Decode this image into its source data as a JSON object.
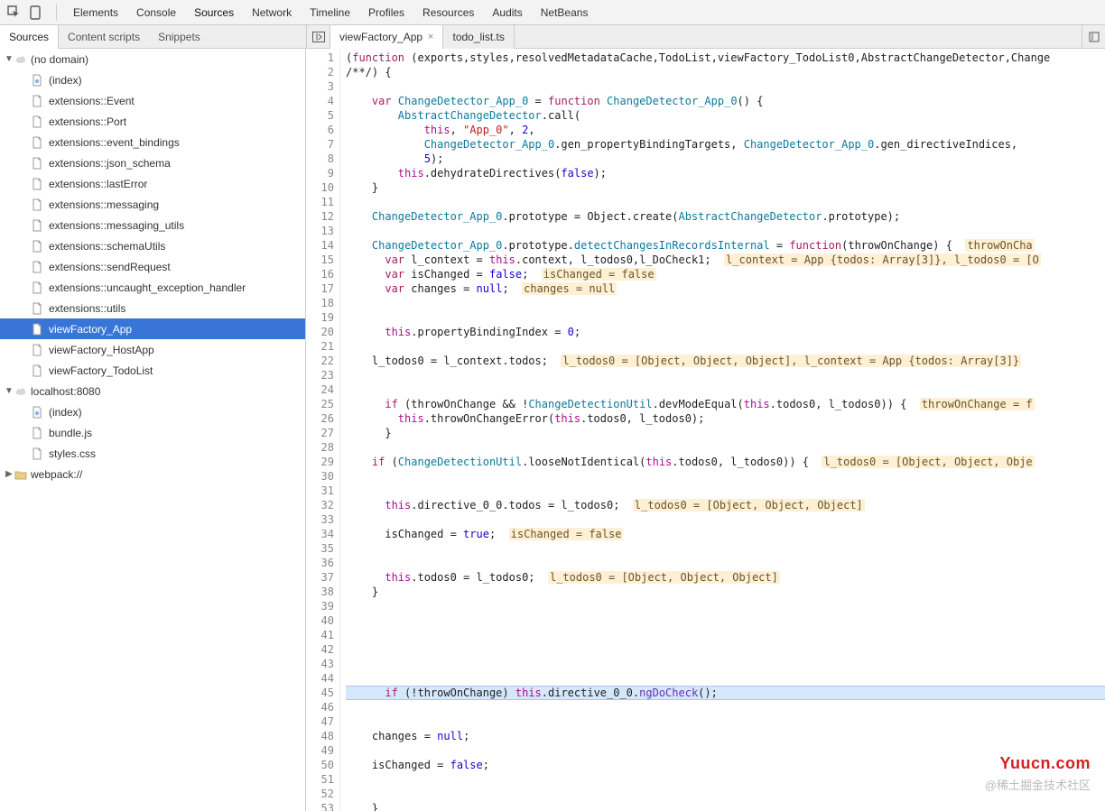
{
  "toolbar": {
    "tabs": [
      "Elements",
      "Console",
      "Sources",
      "Network",
      "Timeline",
      "Profiles",
      "Resources",
      "Audits",
      "NetBeans"
    ],
    "active": "Sources"
  },
  "subtabs": {
    "items": [
      "Sources",
      "Content scripts",
      "Snippets"
    ],
    "active": "Sources"
  },
  "filetabs": {
    "items": [
      {
        "label": "viewFactory_App",
        "close": true
      },
      {
        "label": "todo_list.ts",
        "close": false
      }
    ],
    "active": 0
  },
  "tree": {
    "groups": [
      {
        "label": "(no domain)",
        "icon": "cloud",
        "expanded": true,
        "children": [
          {
            "label": "(index)",
            "icon": "page-special"
          },
          {
            "label": "extensions::Event",
            "icon": "page"
          },
          {
            "label": "extensions::Port",
            "icon": "page"
          },
          {
            "label": "extensions::event_bindings",
            "icon": "page"
          },
          {
            "label": "extensions::json_schema",
            "icon": "page"
          },
          {
            "label": "extensions::lastError",
            "icon": "page"
          },
          {
            "label": "extensions::messaging",
            "icon": "page"
          },
          {
            "label": "extensions::messaging_utils",
            "icon": "page"
          },
          {
            "label": "extensions::schemaUtils",
            "icon": "page"
          },
          {
            "label": "extensions::sendRequest",
            "icon": "page"
          },
          {
            "label": "extensions::uncaught_exception_handler",
            "icon": "page"
          },
          {
            "label": "extensions::utils",
            "icon": "page"
          },
          {
            "label": "viewFactory_App",
            "icon": "page",
            "selected": true
          },
          {
            "label": "viewFactory_HostApp",
            "icon": "page"
          },
          {
            "label": "viewFactory_TodoList",
            "icon": "page"
          }
        ]
      },
      {
        "label": "localhost:8080",
        "icon": "cloud",
        "expanded": true,
        "children": [
          {
            "label": "(index)",
            "icon": "page-special"
          },
          {
            "label": "bundle.js",
            "icon": "page"
          },
          {
            "label": "styles.css",
            "icon": "page"
          }
        ]
      },
      {
        "label": "webpack://",
        "icon": "folder",
        "expanded": false,
        "children": []
      }
    ]
  },
  "lines": {
    "start": 1,
    "end": 53
  },
  "code": [
    {
      "t": "plain",
      "seg": [
        [
          "",
          "("
        ],
        [
          "k",
          "function"
        ],
        [
          "",
          " (exports,styles,resolvedMetadataCache,TodoList,viewFactory_TodoList0,AbstractChangeDetector,Change"
        ]
      ]
    },
    {
      "t": "plain",
      "seg": [
        [
          "",
          "/**/) {"
        ]
      ]
    },
    {
      "t": "plain",
      "seg": [
        [
          "",
          ""
        ]
      ]
    },
    {
      "t": "plain",
      "seg": [
        [
          "",
          "    "
        ],
        [
          "k",
          "var"
        ],
        [
          "",
          " "
        ],
        [
          "f",
          "ChangeDetector_App_0"
        ],
        [
          "",
          " = "
        ],
        [
          "k",
          "function"
        ],
        [
          "",
          " "
        ],
        [
          "f",
          "ChangeDetector_App_0"
        ],
        [
          "",
          "() {"
        ]
      ]
    },
    {
      "t": "plain",
      "seg": [
        [
          "",
          "        "
        ],
        [
          "f",
          "AbstractChangeDetector"
        ],
        [
          "",
          ".call("
        ]
      ]
    },
    {
      "t": "plain",
      "seg": [
        [
          "",
          "            "
        ],
        [
          "t",
          "this"
        ],
        [
          "",
          ", "
        ],
        [
          "s",
          "\"App_0\""
        ],
        [
          "",
          ", "
        ],
        [
          "n",
          "2"
        ],
        [
          "",
          ","
        ]
      ]
    },
    {
      "t": "plain",
      "seg": [
        [
          "",
          "            "
        ],
        [
          "f",
          "ChangeDetector_App_0"
        ],
        [
          "",
          ".gen_propertyBindingTargets, "
        ],
        [
          "f",
          "ChangeDetector_App_0"
        ],
        [
          "",
          ".gen_directiveIndices,"
        ]
      ]
    },
    {
      "t": "plain",
      "seg": [
        [
          "",
          "            "
        ],
        [
          "n",
          "5"
        ],
        [
          "",
          ");"
        ]
      ]
    },
    {
      "t": "plain",
      "seg": [
        [
          "",
          "        "
        ],
        [
          "t",
          "this"
        ],
        [
          "",
          ".dehydrateDirectives("
        ],
        [
          "n",
          "false"
        ],
        [
          "",
          ");"
        ]
      ]
    },
    {
      "t": "plain",
      "seg": [
        [
          "",
          "    }"
        ]
      ]
    },
    {
      "t": "plain",
      "seg": [
        [
          "",
          ""
        ]
      ]
    },
    {
      "t": "plain",
      "seg": [
        [
          "",
          "    "
        ],
        [
          "f",
          "ChangeDetector_App_0"
        ],
        [
          "",
          ".prototype = Object.create("
        ],
        [
          "f",
          "AbstractChangeDetector"
        ],
        [
          "",
          ".prototype);"
        ]
      ]
    },
    {
      "t": "plain",
      "seg": [
        [
          "",
          ""
        ]
      ]
    },
    {
      "t": "plain",
      "seg": [
        [
          "",
          "    "
        ],
        [
          "f",
          "ChangeDetector_App_0"
        ],
        [
          "",
          ".prototype."
        ],
        [
          "f",
          "detectChangesInRecordsInternal"
        ],
        [
          "",
          " = "
        ],
        [
          "k",
          "function"
        ],
        [
          "",
          "(throwOnChange) {  "
        ],
        [
          "hint",
          "throwOnCha"
        ]
      ]
    },
    {
      "t": "plain",
      "seg": [
        [
          "",
          "      "
        ],
        [
          "k",
          "var"
        ],
        [
          "",
          " l_context = "
        ],
        [
          "t",
          "this"
        ],
        [
          "",
          ".context, l_todos0,l_DoCheck1;  "
        ],
        [
          "hint",
          "l_context = App {todos: Array[3]}, l_todos0 = [O"
        ]
      ]
    },
    {
      "t": "plain",
      "seg": [
        [
          "",
          "      "
        ],
        [
          "k",
          "var"
        ],
        [
          "",
          " isChanged = "
        ],
        [
          "n",
          "false"
        ],
        [
          "",
          ";  "
        ],
        [
          "hint",
          "isChanged = false"
        ]
      ]
    },
    {
      "t": "plain",
      "seg": [
        [
          "",
          "      "
        ],
        [
          "k",
          "var"
        ],
        [
          "",
          " changes = "
        ],
        [
          "n",
          "null"
        ],
        [
          "",
          ";  "
        ],
        [
          "hint",
          "changes = null"
        ]
      ]
    },
    {
      "t": "plain",
      "seg": [
        [
          "",
          ""
        ]
      ]
    },
    {
      "t": "plain",
      "seg": [
        [
          "",
          ""
        ]
      ]
    },
    {
      "t": "plain",
      "seg": [
        [
          "",
          "      "
        ],
        [
          "t",
          "this"
        ],
        [
          "",
          ".propertyBindingIndex = "
        ],
        [
          "n",
          "0"
        ],
        [
          "",
          ";"
        ]
      ]
    },
    {
      "t": "plain",
      "seg": [
        [
          "",
          ""
        ]
      ]
    },
    {
      "t": "plain",
      "seg": [
        [
          "",
          "    l_todos0 = l_context.todos;  "
        ],
        [
          "hint",
          "l_todos0 = [Object, Object, Object], l_context = App {todos: Array[3]}"
        ]
      ]
    },
    {
      "t": "plain",
      "seg": [
        [
          "",
          ""
        ]
      ]
    },
    {
      "t": "plain",
      "seg": [
        [
          "",
          ""
        ]
      ]
    },
    {
      "t": "plain",
      "seg": [
        [
          "",
          "      "
        ],
        [
          "k",
          "if"
        ],
        [
          "",
          " (throwOnChange && !"
        ],
        [
          "f",
          "ChangeDetectionUtil"
        ],
        [
          "",
          ".devModeEqual("
        ],
        [
          "t",
          "this"
        ],
        [
          "",
          ".todos0, l_todos0)) {  "
        ],
        [
          "hint",
          "throwOnChange = f"
        ]
      ]
    },
    {
      "t": "plain",
      "seg": [
        [
          "",
          "        "
        ],
        [
          "t",
          "this"
        ],
        [
          "",
          ".throwOnChangeError("
        ],
        [
          "t",
          "this"
        ],
        [
          "",
          ".todos0, l_todos0);"
        ]
      ]
    },
    {
      "t": "plain",
      "seg": [
        [
          "",
          "      }"
        ]
      ]
    },
    {
      "t": "plain",
      "seg": [
        [
          "",
          ""
        ]
      ]
    },
    {
      "t": "plain",
      "seg": [
        [
          "",
          "    "
        ],
        [
          "k",
          "if"
        ],
        [
          "",
          " ("
        ],
        [
          "f",
          "ChangeDetectionUtil"
        ],
        [
          "",
          ".looseNotIdentical("
        ],
        [
          "t",
          "this"
        ],
        [
          "",
          ".todos0, l_todos0)) {  "
        ],
        [
          "hint",
          "l_todos0 = [Object, Object, Obje"
        ]
      ]
    },
    {
      "t": "plain",
      "seg": [
        [
          "",
          ""
        ]
      ]
    },
    {
      "t": "plain",
      "seg": [
        [
          "",
          ""
        ]
      ]
    },
    {
      "t": "plain",
      "seg": [
        [
          "",
          "      "
        ],
        [
          "t",
          "this"
        ],
        [
          "",
          ".directive_0_0.todos = l_todos0;  "
        ],
        [
          "hint",
          "l_todos0 = [Object, Object, Object]"
        ]
      ]
    },
    {
      "t": "plain",
      "seg": [
        [
          "",
          ""
        ]
      ]
    },
    {
      "t": "plain",
      "seg": [
        [
          "",
          "      isChanged = "
        ],
        [
          "n",
          "true"
        ],
        [
          "",
          ";  "
        ],
        [
          "hint",
          "isChanged = false"
        ]
      ]
    },
    {
      "t": "plain",
      "seg": [
        [
          "",
          ""
        ]
      ]
    },
    {
      "t": "plain",
      "seg": [
        [
          "",
          ""
        ]
      ]
    },
    {
      "t": "plain",
      "seg": [
        [
          "",
          "      "
        ],
        [
          "t",
          "this"
        ],
        [
          "",
          ".todos0 = l_todos0;  "
        ],
        [
          "hint",
          "l_todos0 = [Object, Object, Object]"
        ]
      ]
    },
    {
      "t": "plain",
      "seg": [
        [
          "",
          "    }"
        ]
      ]
    },
    {
      "t": "plain",
      "seg": [
        [
          "",
          ""
        ]
      ]
    },
    {
      "t": "plain",
      "seg": [
        [
          "",
          ""
        ]
      ]
    },
    {
      "t": "plain",
      "seg": [
        [
          "",
          ""
        ]
      ]
    },
    {
      "t": "plain",
      "seg": [
        [
          "",
          ""
        ]
      ]
    },
    {
      "t": "plain",
      "seg": [
        [
          "",
          ""
        ]
      ]
    },
    {
      "t": "plain",
      "seg": [
        [
          "",
          ""
        ]
      ]
    },
    {
      "t": "hl",
      "seg": [
        [
          "",
          "      "
        ],
        [
          "k",
          "if"
        ],
        [
          "",
          " (!throwOnChange) "
        ],
        [
          "t",
          "this"
        ],
        [
          "",
          ".directive_0_0."
        ],
        [
          "d",
          "ngDoCheck"
        ],
        [
          "",
          "();"
        ]
      ]
    },
    {
      "t": "plain",
      "seg": [
        [
          "",
          ""
        ]
      ]
    },
    {
      "t": "plain",
      "seg": [
        [
          "",
          ""
        ]
      ]
    },
    {
      "t": "plain",
      "seg": [
        [
          "",
          "    changes = "
        ],
        [
          "n",
          "null"
        ],
        [
          "",
          ";"
        ]
      ]
    },
    {
      "t": "plain",
      "seg": [
        [
          "",
          ""
        ]
      ]
    },
    {
      "t": "plain",
      "seg": [
        [
          "",
          "    isChanged = "
        ],
        [
          "n",
          "false"
        ],
        [
          "",
          ";"
        ]
      ]
    },
    {
      "t": "plain",
      "seg": [
        [
          "",
          ""
        ]
      ]
    },
    {
      "t": "plain",
      "seg": [
        [
          "",
          ""
        ]
      ]
    },
    {
      "t": "plain",
      "seg": [
        [
          "",
          "    }"
        ]
      ]
    }
  ],
  "watermark1": "Yuucn.com",
  "watermark2": "@稀土掘金技术社区"
}
